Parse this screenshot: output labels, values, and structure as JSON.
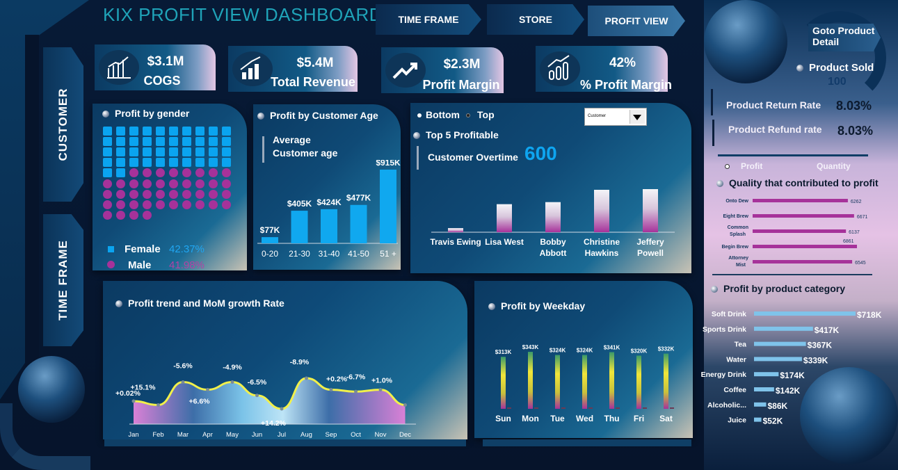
{
  "header": {
    "title": "KIX PROFIT VIEW DASHBOARD"
  },
  "nav": {
    "time_frame": "TIME FRAME",
    "store": "STORE",
    "profit_view": "PROFIT VIEW",
    "goto_product_detail": "Goto Product Detail"
  },
  "side": {
    "customer": "CUSTOMER",
    "time_frame": "TIME FRAME"
  },
  "kpis": [
    {
      "value": "$3.1M",
      "label": "COGS",
      "icon": "bar-chart-icon"
    },
    {
      "value": "$5.4M",
      "label": "Total Revenue",
      "icon": "rising-bars-icon"
    },
    {
      "value": "$2.3M",
      "label": "Profit Margin",
      "icon": "trend-up-icon"
    },
    {
      "value": "42%",
      "label": "% Profit Margin",
      "icon": "percent-bars-icon"
    }
  ],
  "gender": {
    "title": "Profit by gender",
    "female_label": "Female",
    "female_value": "42.37%",
    "male_label": "Male",
    "male_value": "41.98%",
    "female_cells": 42,
    "male_cells": 42,
    "colors": {
      "female": "#0aa4f0",
      "male": "#a6329a"
    }
  },
  "age": {
    "title": "Profit by Customer Age",
    "avg_label_1": "Average",
    "avg_label_2": "Customer age"
  },
  "top5": {
    "radio_bottom": "Bottom",
    "radio_top": "Top",
    "title": "Top 5 Profitable",
    "overtime_label": "Customer Overtime",
    "overtime_value": "600",
    "select_value": "Customer"
  },
  "product": {
    "sold_label": "Product Sold",
    "sold_value": "100",
    "return_label": "Product Return Rate",
    "return_value": "8.03%",
    "refund_label": "Product Refund rate",
    "refund_value": "8.03%",
    "toggle_profit": "Profit",
    "toggle_quantity": "Quantity",
    "quality_title": "Quality that contributed to profit",
    "category_title": "Profit by product category"
  },
  "trend": {
    "title": "Profit trend and MoM growth Rate"
  },
  "weekday": {
    "title": "Profit by Weekday"
  },
  "chart_data": [
    {
      "id": "age",
      "type": "bar",
      "categories": [
        "0-20",
        "21-30",
        "31-40",
        "41-50",
        "51 +"
      ],
      "values": [
        77,
        405,
        424,
        477,
        915
      ],
      "labels": [
        "$77K",
        "$405K",
        "$424K",
        "$477K",
        "$915K"
      ],
      "ylim": [
        0,
        915
      ],
      "color": "#10a8ef"
    },
    {
      "id": "top5",
      "type": "bar",
      "categories": [
        "Travis Ewing",
        "Lisa West",
        "Bobby Abbott",
        "Christine Hawkins",
        "Jeffery Powell"
      ],
      "values": [
        6,
        41,
        44,
        62,
        63
      ]
    },
    {
      "id": "quality",
      "type": "bar",
      "categories": [
        "Onto Dew",
        "Eight Brew",
        "Common Splash",
        "Begin Brew",
        "Attorney Mist"
      ],
      "values": [
        6262,
        6671,
        6137,
        6861,
        6545
      ],
      "color": "#a6329a"
    },
    {
      "id": "category",
      "type": "bar",
      "categories": [
        "Soft Drink",
        "Sports Drink",
        "Tea",
        "Water",
        "Energy Drink",
        "Coffee",
        "Alcoholic...",
        "Juice"
      ],
      "values": [
        718,
        417,
        367,
        339,
        174,
        142,
        86,
        52
      ],
      "labels": [
        "$718K",
        "$417K",
        "$367K",
        "$339K",
        "$174K",
        "$142K",
        "$86K",
        "$52K"
      ],
      "color": "#7fc3ea"
    },
    {
      "id": "trend",
      "type": "area",
      "categories": [
        "Jan",
        "Feb",
        "Mar",
        "Apr",
        "May",
        "Jun",
        "Jul",
        "Aug",
        "Sep",
        "Oct",
        "Nov",
        "Dec"
      ],
      "values": [
        52,
        50,
        62,
        58,
        62,
        55,
        48,
        64,
        58,
        57,
        58,
        50
      ],
      "growth_labels": [
        "+0.02%",
        "+15.1%",
        "-5.6%",
        "+6.6%",
        "-4.9%",
        "-6.5%",
        "+14.2%",
        "-8.9%",
        "+0.2%",
        "-6.7%",
        "+1.0%",
        ""
      ]
    },
    {
      "id": "weekday",
      "type": "bar",
      "categories": [
        "Sun",
        "Mon",
        "Tue",
        "Wed",
        "Thu",
        "Fri",
        "Sat"
      ],
      "values": [
        313,
        343,
        324,
        324,
        341,
        320,
        332
      ],
      "labels": [
        "$313K",
        "$343K",
        "$324K",
        "$324K",
        "$341K",
        "$320K",
        "$332K"
      ],
      "ylim": [
        0,
        343
      ]
    }
  ]
}
